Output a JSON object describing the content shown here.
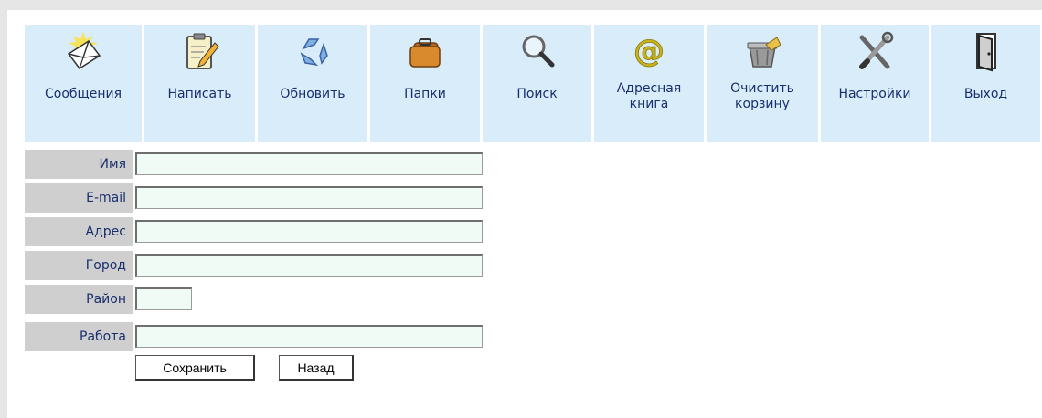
{
  "toolbar": {
    "items": [
      {
        "label": "Сообщения",
        "icon": "envelope-icon"
      },
      {
        "label": "Написать",
        "icon": "clipboard-pencil-icon"
      },
      {
        "label": "Обновить",
        "icon": "refresh-icon"
      },
      {
        "label": "Папки",
        "icon": "briefcase-icon"
      },
      {
        "label": "Поиск",
        "icon": "magnifier-icon"
      },
      {
        "label": "Адресная\nкнига",
        "icon": "at-sign-icon"
      },
      {
        "label": "Очистить\nкорзину",
        "icon": "trash-icon"
      },
      {
        "label": "Настройки",
        "icon": "tools-icon"
      },
      {
        "label": "Выход",
        "icon": "door-icon"
      }
    ]
  },
  "form": {
    "fields": [
      {
        "label": "Имя",
        "value": ""
      },
      {
        "label": "E-mail",
        "value": ""
      },
      {
        "label": "Адрес",
        "value": ""
      },
      {
        "label": "Город",
        "value": ""
      },
      {
        "label": "Район",
        "value": ""
      },
      {
        "label": "Работа",
        "value": ""
      }
    ],
    "save_label": "Сохранить",
    "back_label": "Назад"
  },
  "colors": {
    "toolbar_bg": "#d8ecfa",
    "label_bg": "#cfcfcf",
    "input_bg": "#f1fbf6",
    "text": "#1a2f6e"
  }
}
